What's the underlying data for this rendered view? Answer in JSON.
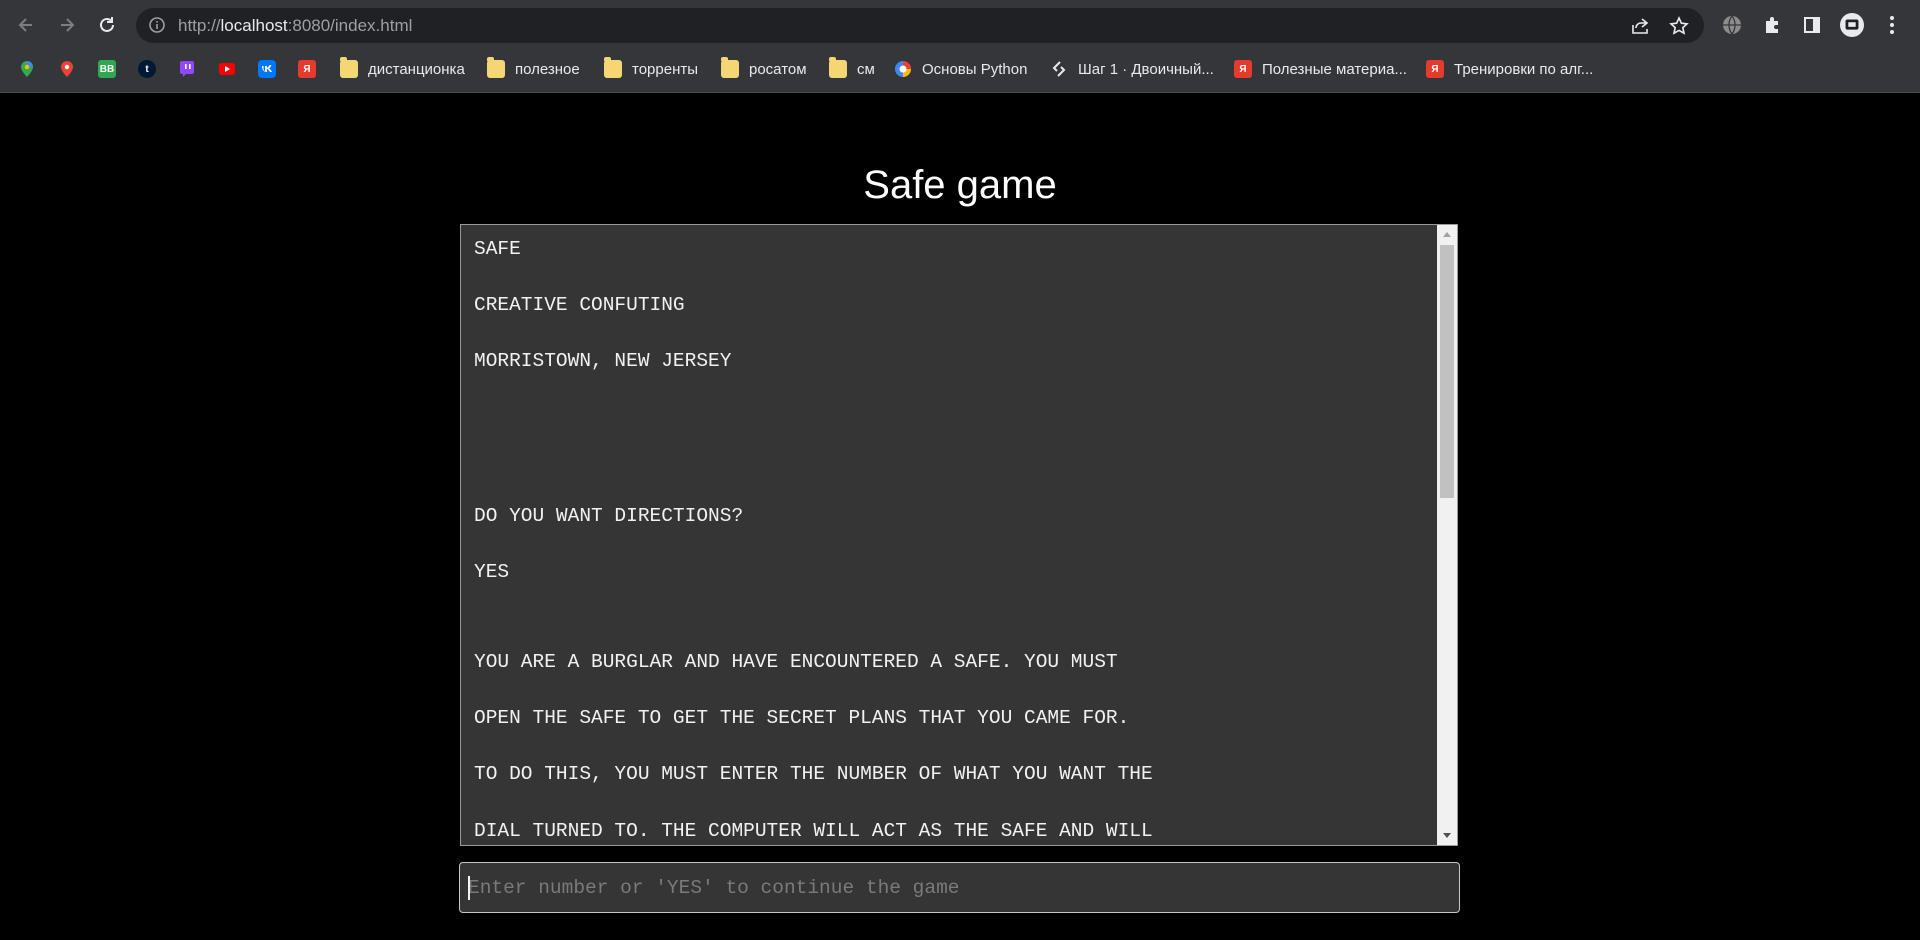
{
  "browser": {
    "url_scheme": "http://",
    "url_host": "localhost",
    "url_rest": ":8080/index.html"
  },
  "bookmarks": [
    {
      "icon": "google-maps-icon",
      "label": ""
    },
    {
      "icon": "map-pin-icon",
      "label": ""
    },
    {
      "icon": "bb-icon",
      "label": "BB"
    },
    {
      "icon": "tumblr-icon",
      "label": "t"
    },
    {
      "icon": "twitch-icon",
      "label": ""
    },
    {
      "icon": "youtube-icon",
      "label": ""
    },
    {
      "icon": "vk-icon",
      "label": ""
    },
    {
      "icon": "yandex-icon",
      "label": "Я"
    },
    {
      "icon": "folder-icon",
      "label": "дистанционка"
    },
    {
      "icon": "folder-icon",
      "label": "полезное"
    },
    {
      "icon": "folder-icon",
      "label": "торренты"
    },
    {
      "icon": "folder-icon",
      "label": "росатом"
    },
    {
      "icon": "folder-icon",
      "label": "см"
    },
    {
      "icon": "python-icon",
      "label": "Основы Python"
    },
    {
      "icon": "stepik-icon",
      "label": "Шаг 1 · Двоичный..."
    },
    {
      "icon": "yandex-icon",
      "label": "Полезные материа..."
    },
    {
      "icon": "yandex-icon",
      "label": "Тренировки по алг..."
    }
  ],
  "page": {
    "title": "Safe game",
    "console_lines": [
      "SAFE",
      "CREATIVE CONFUTING",
      "MORRISTOWN, NEW JERSEY",
      "",
      "",
      "DO YOU WANT DIRECTIONS?",
      "YES",
      "",
      "YOU ARE A BURGLAR AND HAVE ENCOUNTERED A SAFE. YOU MUST",
      "OPEN THE SAFE TO GET THE SECRET PLANS THAT YOU CAME FOR.",
      "TO DO THIS, YOU MUST ENTER THE NUMBER OF WHAT YOU WANT THE",
      "DIAL TURNED TO. THE COMPUTER WILL ACT AS THE SAFE AND WILL"
    ],
    "input_placeholder": "Enter number or 'YES' to continue the game",
    "input_value": ""
  }
}
